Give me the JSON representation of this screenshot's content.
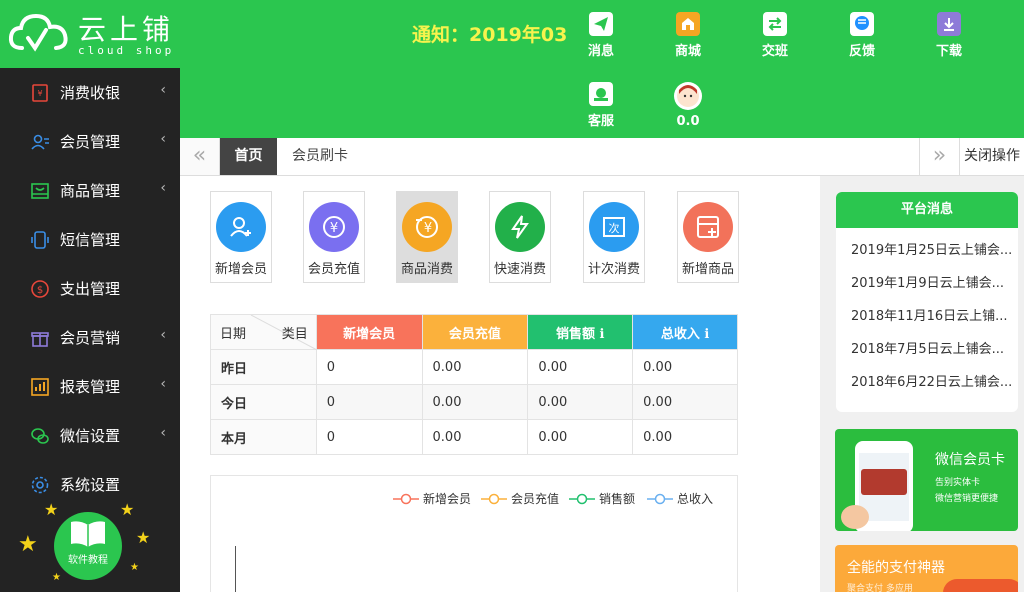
{
  "logo": {
    "cn": "云上铺",
    "en": "cloud shop"
  },
  "notice": "通知：2019年03",
  "header_buttons": [
    {
      "label": "消息",
      "icon": "paper-plane-icon",
      "color": "#ffffff"
    },
    {
      "label": "商城",
      "icon": "store-icon",
      "color": "#f5a623"
    },
    {
      "label": "交班",
      "icon": "swap-icon",
      "color": "#ffffff"
    },
    {
      "label": "反馈",
      "icon": "chat-bubble-icon",
      "color": "#1e90ff"
    },
    {
      "label": "下载",
      "icon": "download-icon",
      "color": "#8e7bd8"
    },
    {
      "label": "客服",
      "icon": "headset-icon",
      "color": "#ffffff"
    },
    {
      "label": "0.0",
      "icon": "avatar-icon",
      "color": "#ffffff"
    }
  ],
  "sidebar": {
    "items": [
      {
        "label": "消费收银",
        "icon": "cashier-icon",
        "color": "#e8473b",
        "arrow": true
      },
      {
        "label": "会员管理",
        "icon": "users-icon",
        "color": "#3a8ee6",
        "arrow": true
      },
      {
        "label": "商品管理",
        "icon": "box-icon",
        "color": "#2bc64f",
        "arrow": true
      },
      {
        "label": "短信管理",
        "icon": "phone-icon",
        "color": "#3a8ee6",
        "arrow": false
      },
      {
        "label": "支出管理",
        "icon": "coin-icon",
        "color": "#e8473b",
        "arrow": false
      },
      {
        "label": "会员营销",
        "icon": "gift-icon",
        "color": "#8e7bd8",
        "arrow": true
      },
      {
        "label": "报表管理",
        "icon": "chart-icon",
        "color": "#f5a623",
        "arrow": true
      },
      {
        "label": "微信设置",
        "icon": "wechat-icon",
        "color": "#2bc64f",
        "arrow": true
      },
      {
        "label": "系统设置",
        "icon": "gear-icon",
        "color": "#3a8ee6",
        "arrow": false
      }
    ],
    "tutorial": "软件教程"
  },
  "tabs": {
    "home": "首页",
    "card": "会员刷卡",
    "close": "关闭操作"
  },
  "quick_actions": [
    {
      "label": "新增会员",
      "icon": "add-user-icon",
      "color": "#2b9cf0"
    },
    {
      "label": "会员充值",
      "icon": "yuan-icon",
      "color": "#7a6ff0"
    },
    {
      "label": "商品消费",
      "icon": "yuan-minus-icon",
      "color": "#f5a623"
    },
    {
      "label": "快速消费",
      "icon": "lightning-icon",
      "color": "#22b04a"
    },
    {
      "label": "计次消费",
      "icon": "count-icon",
      "color": "#2b9cf0"
    },
    {
      "label": "新增商品",
      "icon": "add-product-icon",
      "color": "#f2725a"
    }
  ],
  "stats": {
    "corner_date": "日期",
    "corner_cat": "类目",
    "columns": [
      {
        "label": "新增会员",
        "color": "#f8735b"
      },
      {
        "label": "会员充值",
        "color": "#fbb13c"
      },
      {
        "label": "销售额",
        "color": "#22c06f"
      },
      {
        "label": "总收入",
        "color": "#35a8ee"
      }
    ],
    "info_icon": "ℹ",
    "rows": [
      {
        "label": "昨日",
        "values": [
          "0",
          "0.00",
          "0.00",
          "0.00"
        ]
      },
      {
        "label": "今日",
        "values": [
          "0",
          "0.00",
          "0.00",
          "0.00"
        ]
      },
      {
        "label": "本月",
        "values": [
          "0",
          "0.00",
          "0.00",
          "0.00"
        ]
      }
    ]
  },
  "chart_legend": [
    {
      "name": "新增会员",
      "color": "#f8735b"
    },
    {
      "name": "会员充值",
      "color": "#fbb13c"
    },
    {
      "name": "销售额",
      "color": "#22c06f"
    },
    {
      "name": "总收入",
      "color": "#6ab0f0"
    }
  ],
  "platform": {
    "title": "平台消息",
    "items": [
      "2019年1月25日云上铺会...",
      "2019年1月9日云上铺会...",
      "2018年11月16日云上铺...",
      "2018年7月5日云上铺会...",
      "2018年6月22日云上铺会..."
    ]
  },
  "banner1": {
    "title": "微信会员卡",
    "line1": "告别实体卡",
    "line2": "微信营销更便捷"
  },
  "banner2": {
    "title": "全能的支付神器",
    "sub": "聚合支付 多应用"
  }
}
